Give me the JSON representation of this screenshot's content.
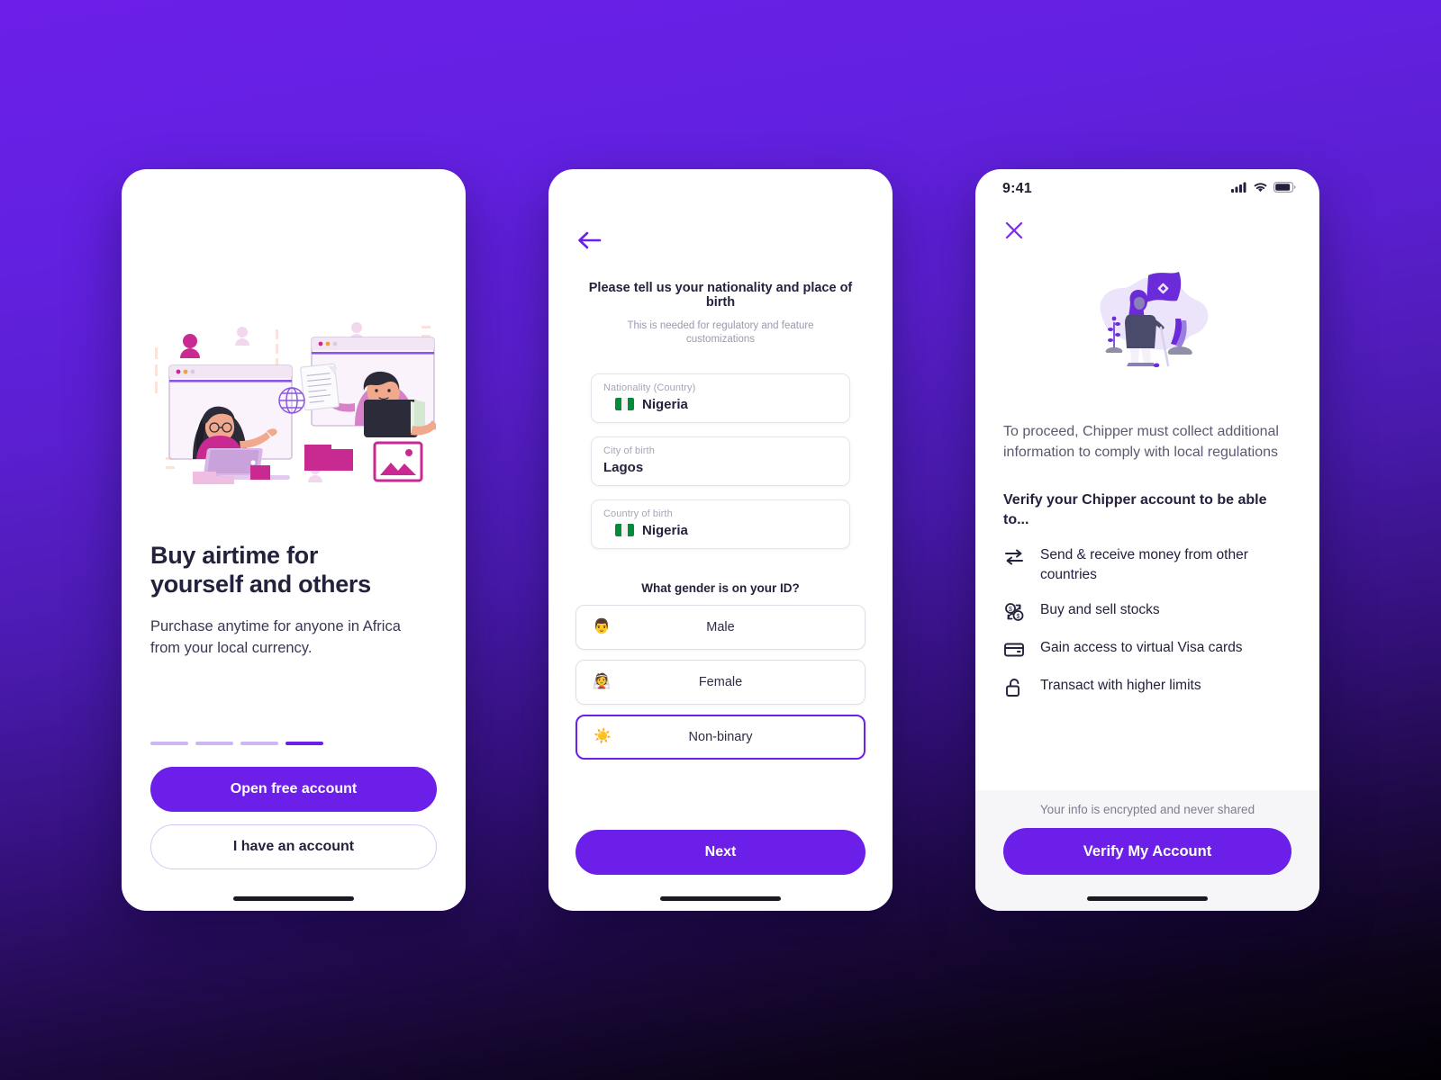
{
  "screen1": {
    "illustration_name": "people-collaborating-illustration",
    "title_line1": "Buy airtime for",
    "title_line2": "yourself and others",
    "subtitle_line1": "Purchase anytime for anyone in Africa",
    "subtitle_line2": "from your local currency.",
    "progress": {
      "total": 4,
      "active_index": 3
    },
    "primary_button": "Open free account",
    "secondary_button": "I have an account"
  },
  "screen2": {
    "back_icon": "arrow-left-icon",
    "title": "Please tell us your nationality and place of birth",
    "subtitle": "This is needed for regulatory and feature customizations",
    "fields": [
      {
        "label": "Nationality (Country)",
        "value": "Nigeria",
        "flag": "nigeria-flag-icon"
      },
      {
        "label": "City of birth",
        "value": "Lagos",
        "flag": ""
      },
      {
        "label": "Country of birth",
        "value": "Nigeria",
        "flag": "nigeria-flag-icon"
      }
    ],
    "gender_question": "What gender is on your ID?",
    "gender_options": [
      {
        "label": "Male",
        "emoji": "👨",
        "icon_name": "man-emoji",
        "selected": false
      },
      {
        "label": "Female",
        "emoji": "👰",
        "icon_name": "woman-emoji",
        "selected": false
      },
      {
        "label": "Non-binary",
        "emoji": "☀️",
        "icon_name": "sun-emoji",
        "selected": true
      }
    ],
    "next_button": "Next"
  },
  "screen3": {
    "status_time": "9:41",
    "status_icons": [
      "cellular-signal-icon",
      "wifi-icon",
      "battery-icon"
    ],
    "close_icon": "close-icon",
    "illustration_name": "woman-with-flag-illustration",
    "lead_text": "To proceed, Chipper must collect additional information to comply with local regulations",
    "heading": "Verify your Chipper account to be able to...",
    "features": [
      {
        "icon": "transfer-arrows-icon",
        "text": "Send & receive money from other countries"
      },
      {
        "icon": "currency-exchange-icon",
        "text": "Buy and sell stocks"
      },
      {
        "icon": "credit-card-icon",
        "text": "Gain access to virtual Visa cards"
      },
      {
        "icon": "unlock-icon",
        "text": "Transact with higher limits"
      }
    ],
    "footer_note": "Your info is encrypted and never shared",
    "cta_button": "Verify My Account"
  },
  "colors": {
    "brand_purple": "#6C1FE8",
    "dark_navy": "#23223c",
    "muted_grey": "#9a99ad",
    "flag_green": "#048c3a",
    "bg_top": "#6C1FE8",
    "bg_bottom": "#020004"
  }
}
